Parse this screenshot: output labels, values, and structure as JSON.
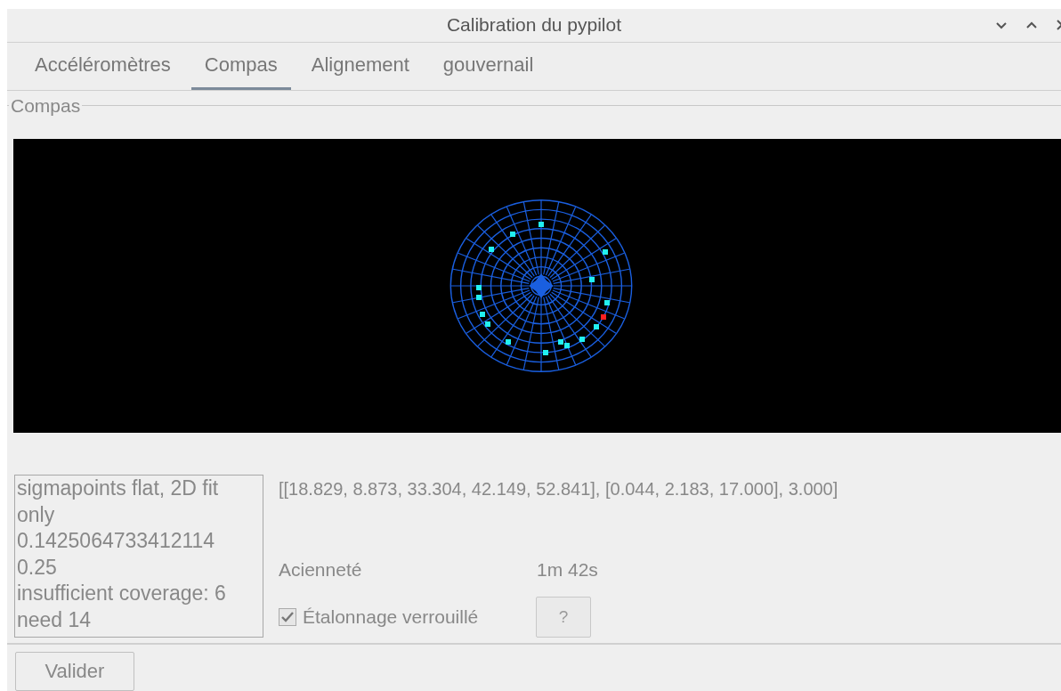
{
  "window": {
    "title": "Calibration du pypilot"
  },
  "tabs": [
    {
      "label": "Accéléromètres",
      "selected": false
    },
    {
      "label": "Compas",
      "selected": true
    },
    {
      "label": "Alignement",
      "selected": false
    },
    {
      "label": "gouvernail",
      "selected": false
    }
  ],
  "group": {
    "title": "Compas"
  },
  "status_lines": [
    "sigmapoints flat, 2D fit only",
    "0.1425064733412114",
    "0.25",
    "insufficient coverage: 6 need 14"
  ],
  "calibration_values": "[[18.829, 8.873, 33.304, 42.149, 52.841], [0.044, 2.183, 17.000], 3.000]",
  "age": {
    "label": "Acienneté",
    "value": "1m 42s"
  },
  "lock": {
    "label": "Étalonnage verrouillé",
    "checked": true
  },
  "help_button": "?",
  "footer_buttons": [
    "Valider"
  ]
}
